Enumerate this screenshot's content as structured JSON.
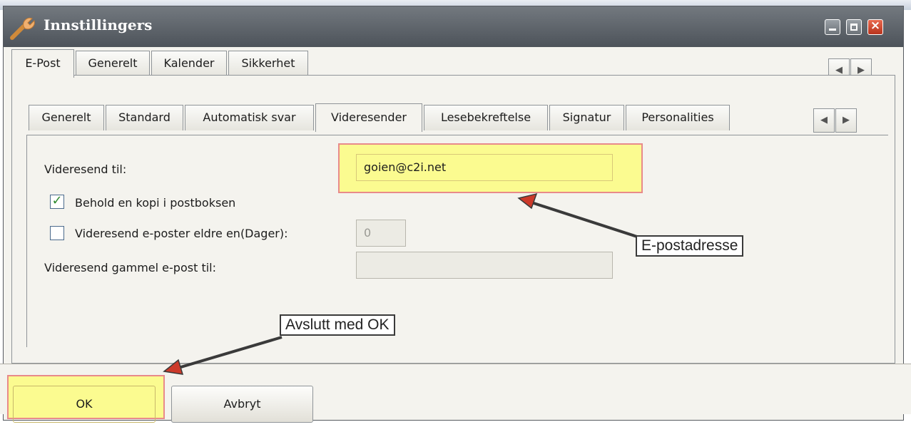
{
  "window": {
    "title": "Innstillingers",
    "title_icon": "wrench-icon",
    "controls": [
      "minimize-icon",
      "maximize-icon",
      "close-icon"
    ]
  },
  "outer_tabs": [
    {
      "label": "E-Post",
      "active": true
    },
    {
      "label": "Generelt",
      "active": false
    },
    {
      "label": "Kalender",
      "active": false
    },
    {
      "label": "Sikkerhet",
      "active": false
    }
  ],
  "inner_tabs": [
    {
      "label": "Generelt",
      "active": false
    },
    {
      "label": "Standard",
      "active": false
    },
    {
      "label": "Automatisk svar",
      "active": false
    },
    {
      "label": "Videresender",
      "active": true
    },
    {
      "label": "Lesebekreftelse",
      "active": false
    },
    {
      "label": "Signatur",
      "active": false
    },
    {
      "label": "Personalities",
      "active": false
    }
  ],
  "scroll_icons": {
    "left": "◀",
    "right": "▶"
  },
  "form": {
    "forward_to_label": "Videresend til:",
    "forward_to_value": "goien@c2i.net",
    "keep_copy_label": "Behold en kopi i postboksen",
    "keep_copy_checked": true,
    "forward_older_label": "Videresend e-poster eldre en(Dager):",
    "forward_older_checked": false,
    "forward_older_days": "0",
    "forward_old_to_label": "Videresend gammel e-post til:",
    "forward_old_to_value": ""
  },
  "callouts": {
    "email_note": "E-postadresse",
    "ok_note": "Avslutt med OK"
  },
  "buttons": {
    "ok": "OK",
    "cancel": "Avbryt"
  },
  "colors": {
    "highlight": "#fcfc78",
    "highlight_border": "#e88a8a",
    "titlebar": "#5f656c",
    "close_button": "#c9452a",
    "checkmark": "#2e8a2e"
  }
}
